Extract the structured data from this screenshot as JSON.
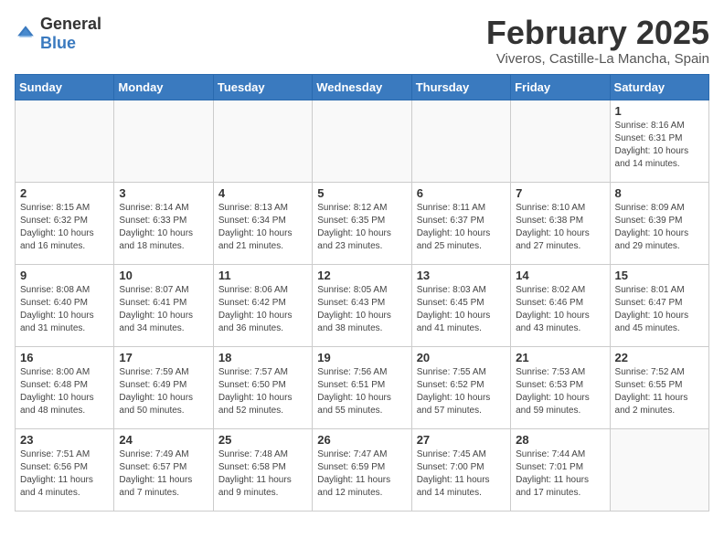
{
  "logo": {
    "general": "General",
    "blue": "Blue"
  },
  "header": {
    "title": "February 2025",
    "subtitle": "Viveros, Castille-La Mancha, Spain"
  },
  "weekdays": [
    "Sunday",
    "Monday",
    "Tuesday",
    "Wednesday",
    "Thursday",
    "Friday",
    "Saturday"
  ],
  "weeks": [
    [
      {
        "day": "",
        "info": ""
      },
      {
        "day": "",
        "info": ""
      },
      {
        "day": "",
        "info": ""
      },
      {
        "day": "",
        "info": ""
      },
      {
        "day": "",
        "info": ""
      },
      {
        "day": "",
        "info": ""
      },
      {
        "day": "1",
        "info": "Sunrise: 8:16 AM\nSunset: 6:31 PM\nDaylight: 10 hours and 14 minutes."
      }
    ],
    [
      {
        "day": "2",
        "info": "Sunrise: 8:15 AM\nSunset: 6:32 PM\nDaylight: 10 hours and 16 minutes."
      },
      {
        "day": "3",
        "info": "Sunrise: 8:14 AM\nSunset: 6:33 PM\nDaylight: 10 hours and 18 minutes."
      },
      {
        "day": "4",
        "info": "Sunrise: 8:13 AM\nSunset: 6:34 PM\nDaylight: 10 hours and 21 minutes."
      },
      {
        "day": "5",
        "info": "Sunrise: 8:12 AM\nSunset: 6:35 PM\nDaylight: 10 hours and 23 minutes."
      },
      {
        "day": "6",
        "info": "Sunrise: 8:11 AM\nSunset: 6:37 PM\nDaylight: 10 hours and 25 minutes."
      },
      {
        "day": "7",
        "info": "Sunrise: 8:10 AM\nSunset: 6:38 PM\nDaylight: 10 hours and 27 minutes."
      },
      {
        "day": "8",
        "info": "Sunrise: 8:09 AM\nSunset: 6:39 PM\nDaylight: 10 hours and 29 minutes."
      }
    ],
    [
      {
        "day": "9",
        "info": "Sunrise: 8:08 AM\nSunset: 6:40 PM\nDaylight: 10 hours and 31 minutes."
      },
      {
        "day": "10",
        "info": "Sunrise: 8:07 AM\nSunset: 6:41 PM\nDaylight: 10 hours and 34 minutes."
      },
      {
        "day": "11",
        "info": "Sunrise: 8:06 AM\nSunset: 6:42 PM\nDaylight: 10 hours and 36 minutes."
      },
      {
        "day": "12",
        "info": "Sunrise: 8:05 AM\nSunset: 6:43 PM\nDaylight: 10 hours and 38 minutes."
      },
      {
        "day": "13",
        "info": "Sunrise: 8:03 AM\nSunset: 6:45 PM\nDaylight: 10 hours and 41 minutes."
      },
      {
        "day": "14",
        "info": "Sunrise: 8:02 AM\nSunset: 6:46 PM\nDaylight: 10 hours and 43 minutes."
      },
      {
        "day": "15",
        "info": "Sunrise: 8:01 AM\nSunset: 6:47 PM\nDaylight: 10 hours and 45 minutes."
      }
    ],
    [
      {
        "day": "16",
        "info": "Sunrise: 8:00 AM\nSunset: 6:48 PM\nDaylight: 10 hours and 48 minutes."
      },
      {
        "day": "17",
        "info": "Sunrise: 7:59 AM\nSunset: 6:49 PM\nDaylight: 10 hours and 50 minutes."
      },
      {
        "day": "18",
        "info": "Sunrise: 7:57 AM\nSunset: 6:50 PM\nDaylight: 10 hours and 52 minutes."
      },
      {
        "day": "19",
        "info": "Sunrise: 7:56 AM\nSunset: 6:51 PM\nDaylight: 10 hours and 55 minutes."
      },
      {
        "day": "20",
        "info": "Sunrise: 7:55 AM\nSunset: 6:52 PM\nDaylight: 10 hours and 57 minutes."
      },
      {
        "day": "21",
        "info": "Sunrise: 7:53 AM\nSunset: 6:53 PM\nDaylight: 10 hours and 59 minutes."
      },
      {
        "day": "22",
        "info": "Sunrise: 7:52 AM\nSunset: 6:55 PM\nDaylight: 11 hours and 2 minutes."
      }
    ],
    [
      {
        "day": "23",
        "info": "Sunrise: 7:51 AM\nSunset: 6:56 PM\nDaylight: 11 hours and 4 minutes."
      },
      {
        "day": "24",
        "info": "Sunrise: 7:49 AM\nSunset: 6:57 PM\nDaylight: 11 hours and 7 minutes."
      },
      {
        "day": "25",
        "info": "Sunrise: 7:48 AM\nSunset: 6:58 PM\nDaylight: 11 hours and 9 minutes."
      },
      {
        "day": "26",
        "info": "Sunrise: 7:47 AM\nSunset: 6:59 PM\nDaylight: 11 hours and 12 minutes."
      },
      {
        "day": "27",
        "info": "Sunrise: 7:45 AM\nSunset: 7:00 PM\nDaylight: 11 hours and 14 minutes."
      },
      {
        "day": "28",
        "info": "Sunrise: 7:44 AM\nSunset: 7:01 PM\nDaylight: 11 hours and 17 minutes."
      },
      {
        "day": "",
        "info": ""
      }
    ]
  ]
}
